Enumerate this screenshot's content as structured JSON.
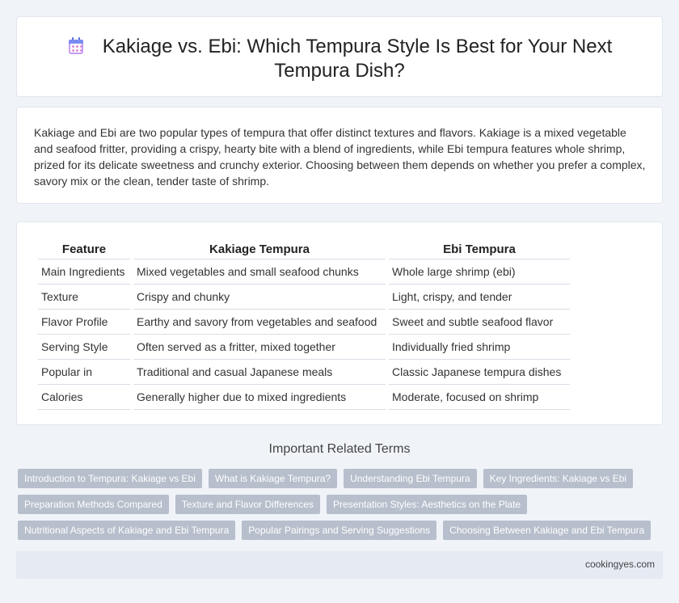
{
  "header": {
    "icon": "calendar-icon",
    "title_line1": "Kakiage vs. Ebi: Which Tempura Style Is Best for Your Next",
    "title_line2": "Tempura Dish?"
  },
  "intro": {
    "text": "Kakiage and Ebi are two popular types of tempura that offer distinct textures and flavors. Kakiage is a mixed vegetable and seafood fritter, providing a crispy, hearty bite with a blend of ingredients, while Ebi tempura features whole shrimp, prized for its delicate sweetness and crunchy exterior. Choosing between them depends on whether you prefer a complex, savory mix or the clean, tender taste of shrimp."
  },
  "table": {
    "headers": [
      "Feature",
      "Kakiage Tempura",
      "Ebi Tempura"
    ],
    "rows": [
      [
        "Main Ingredients",
        "Mixed vegetables and small seafood chunks",
        "Whole large shrimp (ebi)"
      ],
      [
        "Texture",
        "Crispy and chunky",
        "Light, crispy, and tender"
      ],
      [
        "Flavor Profile",
        "Earthy and savory from vegetables and seafood",
        "Sweet and subtle seafood flavor"
      ],
      [
        "Serving Style",
        "Often served as a fritter, mixed together",
        "Individually fried shrimp"
      ],
      [
        "Popular in",
        "Traditional and casual Japanese meals",
        "Classic Japanese tempura dishes"
      ],
      [
        "Calories",
        "Generally higher due to mixed ingredients",
        "Moderate, focused on shrimp"
      ]
    ]
  },
  "related": {
    "heading": "Important Related Terms",
    "tags": [
      [
        "Introduction to Tempura: Kakiage vs Ebi",
        "What is Kakiage Tempura?",
        "Understanding Ebi Tempura",
        "Key Ingredients: Kakiage vs Ebi"
      ],
      [
        "Preparation Methods Compared",
        "Texture and Flavor Differences",
        "Presentation Styles: Aesthetics on the Plate"
      ],
      [
        "Nutritional Aspects of Kakiage and Ebi Tempura",
        "Popular Pairings and Serving Suggestions",
        "Choosing Between Kakiage and Ebi Tempura"
      ]
    ]
  },
  "footer": {
    "site": "cookingyes.com"
  },
  "colors": {
    "background": "#f0f3f8",
    "tag": "#b7bfcc",
    "footer": "#e5eaf3"
  }
}
